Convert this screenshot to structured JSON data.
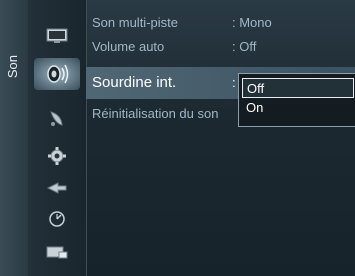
{
  "side_tab": {
    "label": "Son"
  },
  "icons": [
    {
      "name": "picture-icon"
    },
    {
      "name": "sound-icon"
    },
    {
      "name": "channel-icon"
    },
    {
      "name": "setup-icon"
    },
    {
      "name": "input-icon"
    },
    {
      "name": "application-icon"
    },
    {
      "name": "support-icon"
    }
  ],
  "menu": {
    "multitrack": {
      "label": "Son multi-piste",
      "value": ": Mono"
    },
    "auto_volume": {
      "label": "Volume auto",
      "value": ": Off"
    },
    "internal_mute": {
      "label": "Sourdine int.",
      "value": ":"
    },
    "reset": {
      "label": "Réinitialisation du son"
    }
  },
  "dropdown": {
    "options": [
      {
        "label": "Off"
      },
      {
        "label": "On"
      }
    ],
    "selected": "Off"
  },
  "colors": {
    "highlight": "#506775",
    "text_dim": "#9fb8c7",
    "text_bright": "#ffffff"
  }
}
